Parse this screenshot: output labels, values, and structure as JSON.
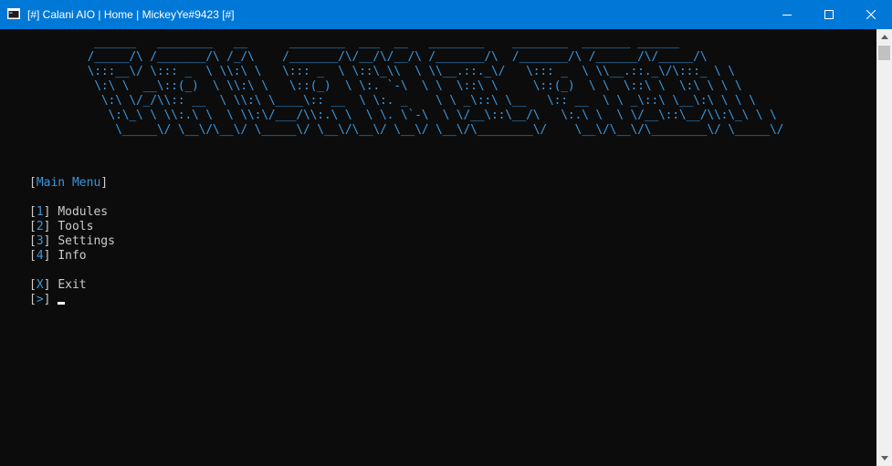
{
  "window": {
    "title": "[#] Calani AIO | Home | MickeyYe#9423 [#]"
  },
  "banner": {
    "ascii": "  ______   ________   __      ________  ___  __   ________    ________  _______ ______\n /_____/\\ /_______/\\ /_/\\    /_______/\\/__/\\/__/\\ /_______/\\  /_______/\\ /______/\\/_____/\\\n \\:::__\\/ \\::: _  \\ \\\\:\\ \\   \\::: _  \\ \\::\\_\\\\  \\ \\\\__.::._\\/   \\::: _  \\ \\\\__.::._\\/\\:::_ \\ \\\n  \\:\\ \\  __\\::(_)  \\ \\\\:\\ \\   \\::(_)  \\ \\:. `-\\  \\ \\  \\::\\ \\     \\::(_)  \\ \\  \\::\\ \\  \\:\\ \\ \\ \\\n   \\:\\ \\/_/\\\\:: __  \\ \\\\:\\ \\____\\:: __  \\ \\:. _    \\ \\ _\\::\\ \\__   \\:: __  \\ \\ _\\::\\ \\__\\:\\ \\ \\ \\\n    \\:\\_\\ \\ \\\\:.\\ \\  \\ \\\\:\\/___/\\\\:.\\ \\  \\ \\. \\`-\\  \\ \\/__\\::\\__/\\   \\:.\\ \\  \\ \\/__\\::\\__/\\\\:\\_\\ \\ \\\n     \\_____\\/ \\__\\/\\__\\/ \\_____\\/ \\__\\/\\__\\/ \\__\\/ \\__\\/\\________\\/    \\__\\/\\__\\/\\________\\/ \\_____\\/"
  },
  "menu": {
    "title_open": "[",
    "title": "Main Menu",
    "title_close": "]",
    "items": [
      {
        "key": "1",
        "label": "Modules"
      },
      {
        "key": "2",
        "label": "Tools"
      },
      {
        "key": "3",
        "label": "Settings"
      },
      {
        "key": "4",
        "label": "Info"
      }
    ],
    "exit": {
      "key": "X",
      "label": "Exit"
    },
    "prompt": {
      "key": ">"
    }
  },
  "colors": {
    "titlebar": "#0078d7",
    "console_bg": "#0c0c0c",
    "accent": "#3a96dd",
    "text": "#cccccc"
  }
}
